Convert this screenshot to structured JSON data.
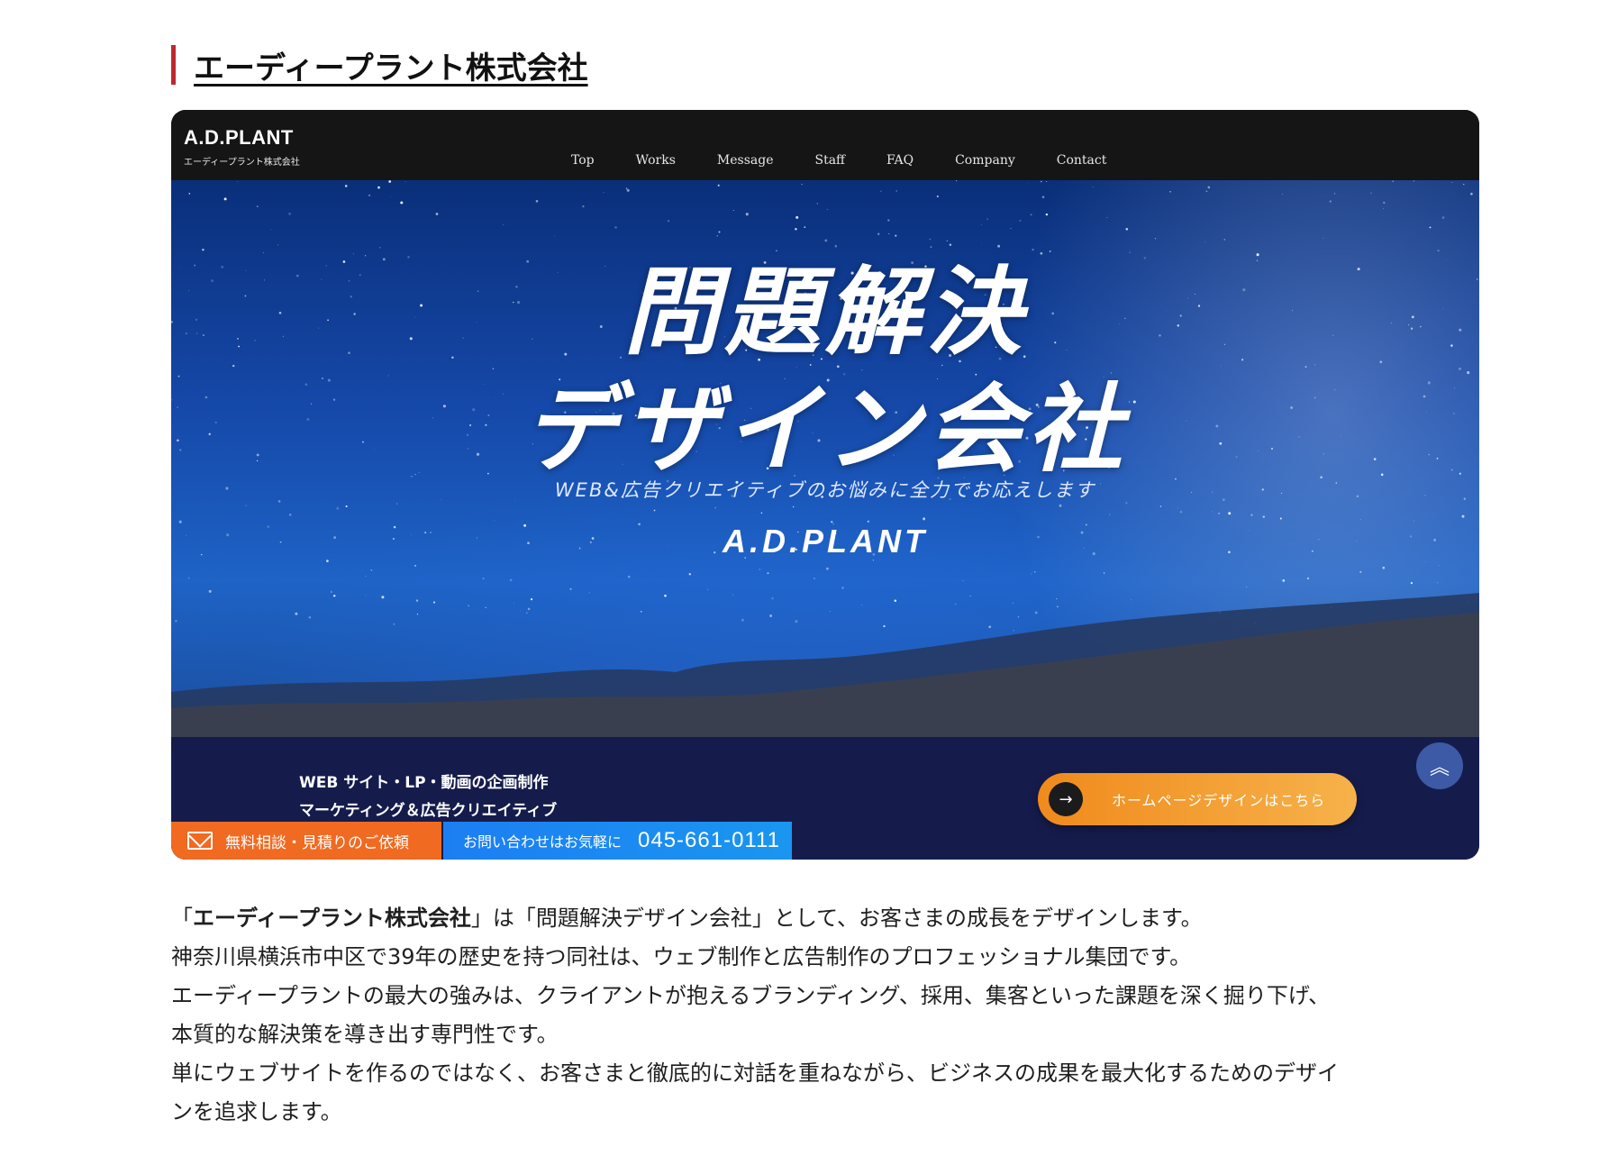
{
  "heading": {
    "title": "エーディープラント株式会社"
  },
  "site": {
    "logo": {
      "main": "A.D.PLANT",
      "sub": "エーディープラント株式会社"
    },
    "nav": [
      "Top",
      "Works",
      "Message",
      "Staff",
      "FAQ",
      "Company",
      "Contact"
    ],
    "hero": {
      "title_line1": "問題解決",
      "title_line2": "デザイン会社",
      "tagline": "WEB&広告クリエイティブのお悩みに全力でお応えします",
      "brand": "A.D.PLANT"
    },
    "services": {
      "line1": "WEB サイト・LP・動画の企画制作",
      "line2": "マーケティング＆広告クリエイティブ"
    },
    "cta": {
      "label": "ホームページデザインはこちら",
      "arrow": "→"
    },
    "scroll_top": "︽",
    "consult": {
      "label": "無料相談・見積りのご依頼"
    },
    "contact": {
      "label": "お問い合わせはお気軽に",
      "phone": "045-661-0111"
    },
    "colors": {
      "header": "#151515",
      "band": "#151c4c",
      "cta": "#f08a1c",
      "consult": "#f06a21",
      "contact": "#1c7ef2",
      "accent_bar": "#c0282d"
    }
  },
  "description": {
    "line1_open": "「",
    "line1_bold": "エーディープラント株式会社",
    "line1_rest": "」は「問題解決デザイン会社」として、お客さまの成長をデザインします。",
    "line2": "神奈川県横浜市中区で39年の歴史を持つ同社は、ウェブ制作と広告制作のプロフェッショナル集団です。",
    "line3": "エーディープラントの最大の強みは、クライアントが抱えるブランディング、採用、集客といった課題を深く掘り下げ、",
    "line4": "本質的な解決策を導き出す専門性です。",
    "line5": "単にウェブサイトを作るのではなく、お客さまと徹底的に対話を重ねながら、ビジネスの成果を最大化するためのデザイ",
    "line6": "ンを追求します。"
  }
}
